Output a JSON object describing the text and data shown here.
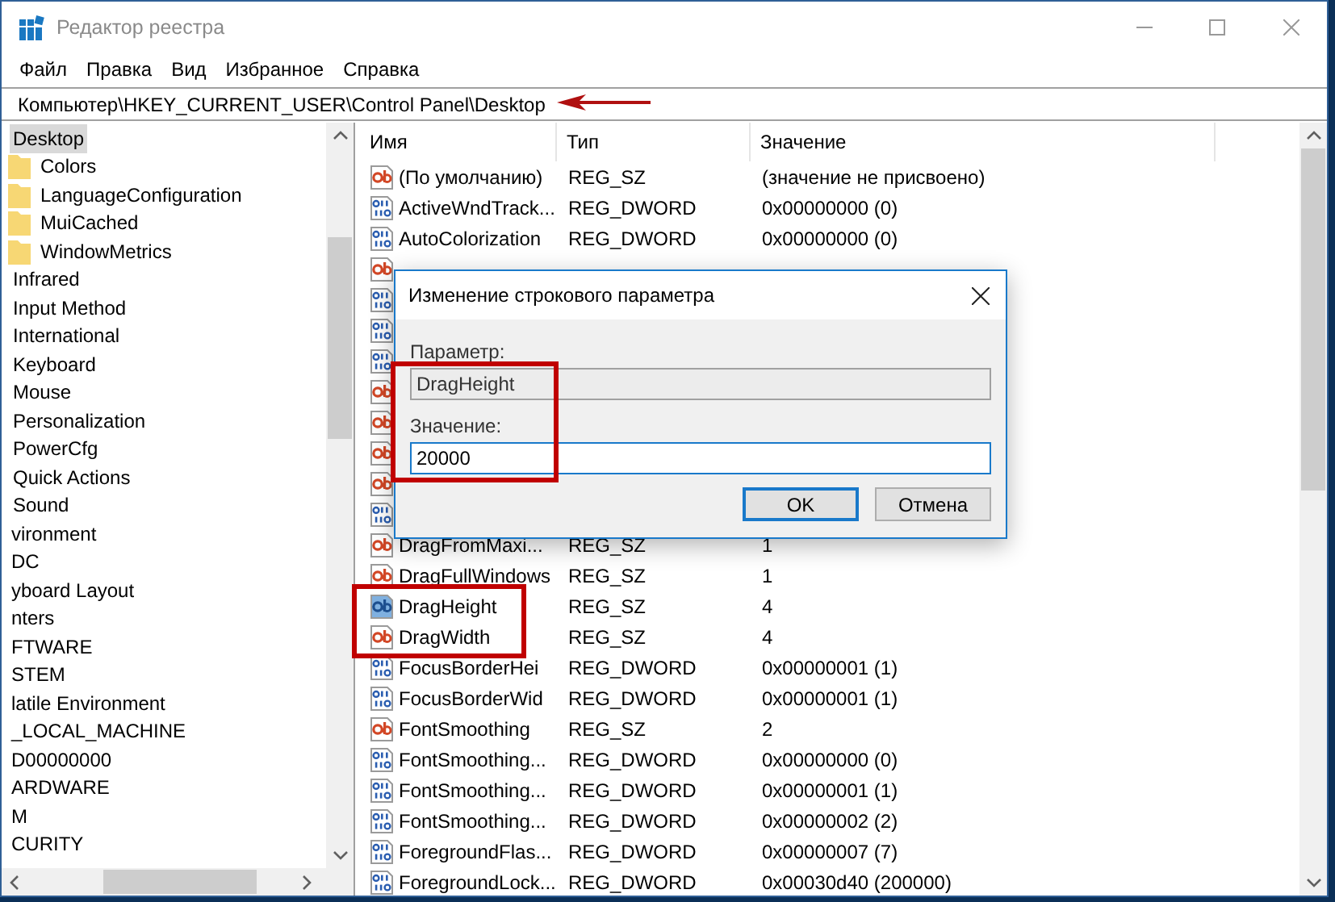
{
  "window": {
    "title": "Редактор реестра"
  },
  "menu": [
    "Файл",
    "Правка",
    "Вид",
    "Избранное",
    "Справка"
  ],
  "address": "Компьютер\\HKEY_CURRENT_USER\\Control Panel\\Desktop",
  "tree": [
    {
      "children": [
        {
          "children": [
            {
              "children": [
                {
                  "label": "Desktop",
                  "selected": true,
                  "children": [
                    {
                      "label": "Colors",
                      "selected": false
                    },
                    {
                      "label": "LanguageConfiguration",
                      "selected": false
                    },
                    {
                      "label": "MuiCached",
                      "selected": false
                    },
                    {
                      "label": "WindowMetrics",
                      "selected": false
                    }
                  ]
                },
                {
                  "label": "Infrared",
                  "selected": false
                },
                {
                  "label": "Input Method",
                  "selected": false
                },
                {
                  "label": "International",
                  "selected": false
                },
                {
                  "label": "Keyboard",
                  "selected": false
                },
                {
                  "label": "Mouse",
                  "selected": false
                },
                {
                  "label": "Personalization",
                  "selected": false
                },
                {
                  "label": "PowerCfg",
                  "selected": false
                },
                {
                  "label": "Quick Actions",
                  "selected": false
                },
                {
                  "label": "Sound",
                  "selected": false
                }
              ]
            },
            {
              "label": "vironment",
              "selected": false
            },
            {
              "label": "DC",
              "selected": false
            },
            {
              "label": "yboard Layout",
              "selected": false
            },
            {
              "label": "nters",
              "selected": false
            },
            {
              "label": "FTWARE",
              "selected": false
            },
            {
              "label": "STEM",
              "selected": false
            },
            {
              "label": "latile Environment",
              "selected": false
            }
          ]
        },
        {
          "label": "_LOCAL_MACHINE",
          "selected": false,
          "children": [
            {
              "label": "D00000000",
              "selected": false
            },
            {
              "label": "ARDWARE",
              "selected": false
            },
            {
              "label": "M",
              "selected": false
            },
            {
              "label": "CURITY",
              "selected": false
            }
          ]
        }
      ]
    }
  ],
  "columns": [
    "Имя",
    "Тип",
    "Значение"
  ],
  "rows": [
    {
      "kind": "sz",
      "name": "(По умолчанию)",
      "type": "REG_SZ",
      "value": "(значение не присвоено)",
      "selected": false
    },
    {
      "kind": "dword",
      "name": "ActiveWndTrack...",
      "type": "REG_DWORD",
      "value": "0x00000000 (0)",
      "selected": false
    },
    {
      "kind": "dword",
      "name": "AutoColorization",
      "type": "REG_DWORD",
      "value": "0x00000000 (0)",
      "selected": false
    },
    {
      "kind": "sz",
      "selected": false
    },
    {
      "kind": "dword",
      "selected": false
    },
    {
      "kind": "dword",
      "selected": false
    },
    {
      "kind": "dword",
      "selected": false
    },
    {
      "kind": "sz",
      "selected": false
    },
    {
      "kind": "sz",
      "selected": false
    },
    {
      "kind": "sz",
      "selected": false
    },
    {
      "kind": "sz",
      "selected": false
    },
    {
      "kind": "dword",
      "selected": false
    },
    {
      "kind": "sz",
      "name": "DragFromMaxi...",
      "type": "REG_SZ",
      "value": "1",
      "selected": false
    },
    {
      "kind": "sz",
      "name": "DragFullWindows",
      "type": "REG_SZ",
      "value": "1",
      "selected": false
    },
    {
      "kind": "sz",
      "name": "DragHeight",
      "type": "REG_SZ",
      "value": "4",
      "selected": true
    },
    {
      "kind": "sz",
      "name": "DragWidth",
      "type": "REG_SZ",
      "value": "4",
      "selected": false
    },
    {
      "kind": "dword",
      "name": "FocusBorderHei",
      "type": "REG_DWORD",
      "value": "0x00000001 (1)",
      "selected": false
    },
    {
      "kind": "dword",
      "name": "FocusBorderWid",
      "type": "REG_DWORD",
      "value": "0x00000001 (1)",
      "selected": false
    },
    {
      "kind": "sz",
      "name": "FontSmoothing",
      "type": "REG_SZ",
      "value": "2",
      "selected": false
    },
    {
      "kind": "dword",
      "name": "FontSmoothing...",
      "type": "REG_DWORD",
      "value": "0x00000000 (0)",
      "selected": false
    },
    {
      "kind": "dword",
      "name": "FontSmoothing...",
      "type": "REG_DWORD",
      "value": "0x00000001 (1)",
      "selected": false
    },
    {
      "kind": "dword",
      "name": "FontSmoothing...",
      "type": "REG_DWORD",
      "value": "0x00000002 (2)",
      "selected": false
    },
    {
      "kind": "dword",
      "name": "ForegroundFlas...",
      "type": "REG_DWORD",
      "value": "0x00000007 (7)",
      "selected": false
    },
    {
      "kind": "dword",
      "name": "ForegroundLock...",
      "type": "REG_DWORD",
      "value": "0x00030d40 (200000)",
      "selected": false
    }
  ],
  "dialog": {
    "title": "Изменение строкового параметра",
    "name_label": "Параметр:",
    "name_value": "DragHeight",
    "value_label": "Значение:",
    "value": "20000",
    "buttons": [
      {
        "label": "OK",
        "default": true
      },
      {
        "label": "Отмена",
        "default": false
      }
    ]
  }
}
